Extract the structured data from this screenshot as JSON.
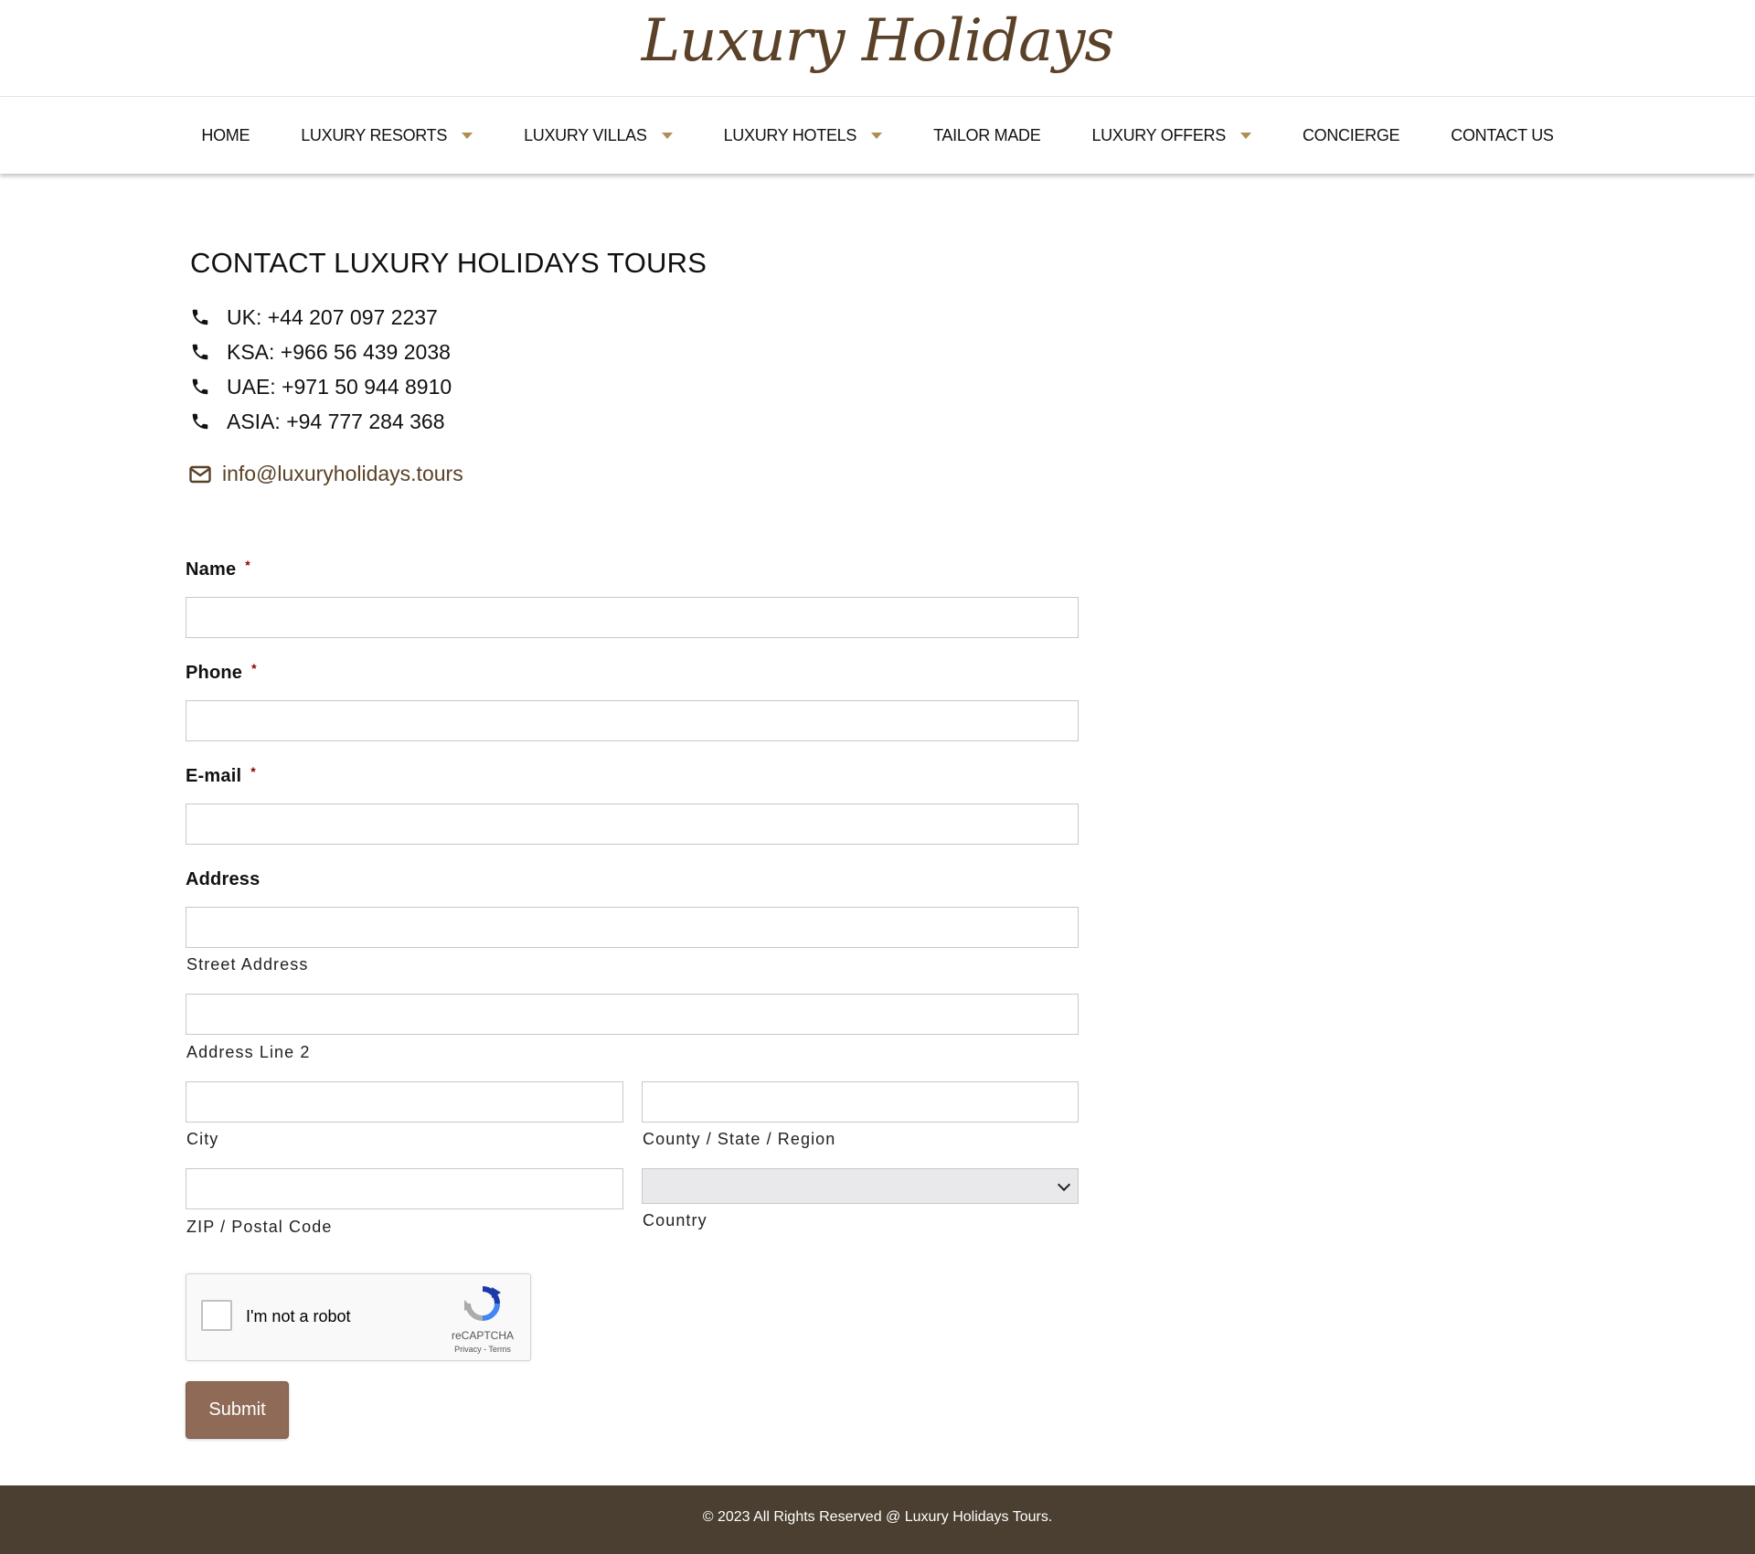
{
  "brand": {
    "logo_text": "Luxury Holidays",
    "logo_color": "#5a4128"
  },
  "nav": {
    "items": [
      {
        "label": "HOME",
        "has_dropdown": false
      },
      {
        "label": "LUXURY RESORTS",
        "has_dropdown": true
      },
      {
        "label": "LUXURY VILLAS",
        "has_dropdown": true
      },
      {
        "label": "LUXURY HOTELS",
        "has_dropdown": true
      },
      {
        "label": "TAILOR MADE",
        "has_dropdown": false
      },
      {
        "label": "LUXURY OFFERS",
        "has_dropdown": true
      },
      {
        "label": "CONCIERGE",
        "has_dropdown": false
      },
      {
        "label": "CONTACT US",
        "has_dropdown": false
      }
    ],
    "caret_color": "#b08d57"
  },
  "contact": {
    "heading": "CONTACT LUXURY HOLIDAYS TOURS",
    "phones": [
      "UK: +44 207 097 2237",
      "KSA: +966 56 439 2038",
      "UAE: +971 50 944 8910",
      "ASIA: +94 777 284 368"
    ],
    "email": "info@luxuryholidays.tours"
  },
  "form": {
    "name_label": "Name",
    "phone_label": "Phone",
    "email_label": "E-mail",
    "required_mark": "*",
    "address_label": "Address",
    "street_label": "Street Address",
    "line2_label": "Address Line 2",
    "city_label": "City",
    "region_label": "County / State / Region",
    "zip_label": "ZIP / Postal Code",
    "country_label": "Country",
    "name_value": "",
    "phone_value": "",
    "email_value": "",
    "street_value": "",
    "line2_value": "",
    "city_value": "",
    "region_value": "",
    "zip_value": "",
    "country_value": ""
  },
  "captcha": {
    "label": "I'm not a robot",
    "brand": "reCAPTCHA",
    "links": "Privacy - Terms"
  },
  "submit_label": "Submit",
  "submit_color": "#8f6a57",
  "footer": {
    "text": "© 2023 All Rights Reserved @ Luxury Holidays Tours.",
    "bg": "#4a3f31"
  }
}
